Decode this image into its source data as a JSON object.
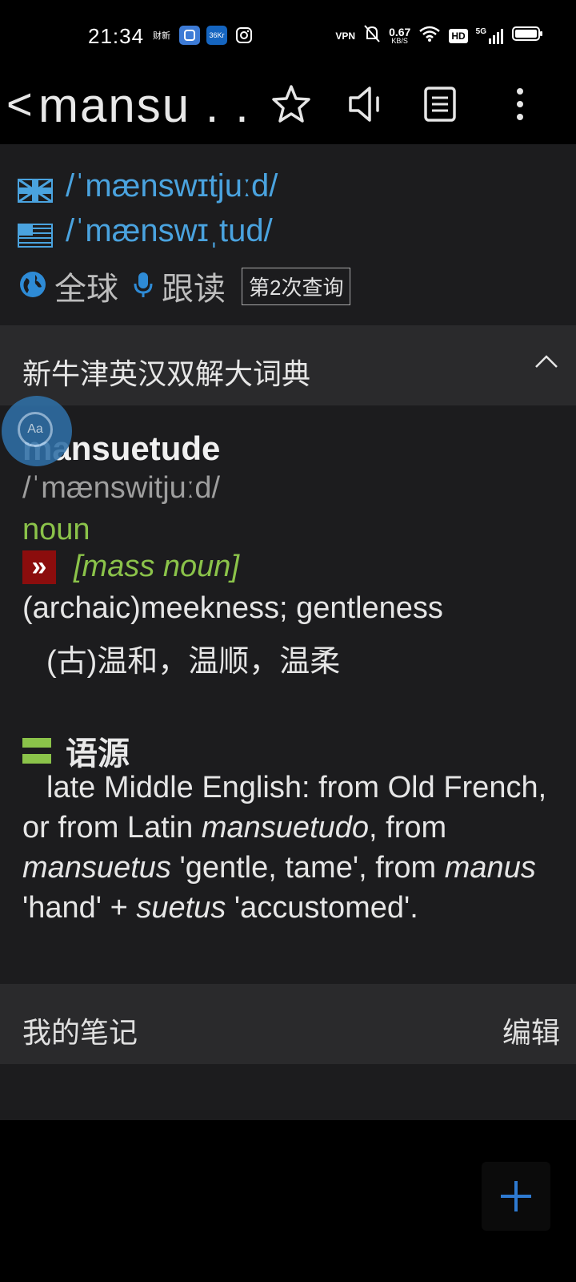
{
  "status_bar": {
    "time": "21:34",
    "app_icons": [
      "财新",
      "36Kr"
    ],
    "network_speed": "0.67",
    "network_unit": "KB/S",
    "vpn": "VPN",
    "hd": "HD",
    "signal": "5G"
  },
  "toolbar": {
    "title": "mansu . .",
    "back": "<"
  },
  "pronunciation": {
    "uk": "/ˈmænswɪtjuːd/",
    "us": "/ˈmænswɪˌtud/",
    "global_label": "全球",
    "follow_read_label": "跟读",
    "lookup_count": "第2次查询"
  },
  "dictionary": {
    "name": "新牛津英汉双解大词典",
    "headword": "mansuetude",
    "ipa": "/ˈmænswitjuːd/",
    "pos": "noun",
    "sense_marker": "»",
    "grammar": "[mass noun]",
    "definition_en": "(archaic)meekness; gentleness",
    "definition_zh": "(古)温和，温顺，温柔",
    "etymology_label": "语源",
    "etymology": {
      "t1": "late Middle English: from Old French, or from Latin ",
      "i1": "mansuetudo",
      "t2": ", from ",
      "i2": "mansuetus",
      "t3": " 'gentle, tame', from ",
      "i3": "manus",
      "t4": " 'hand' + ",
      "i4": "suetus",
      "t5": " 'accustomed'."
    }
  },
  "floating_button": {
    "label": "Aa"
  },
  "notes": {
    "label": "我的笔记",
    "edit": "编辑"
  },
  "colors": {
    "accent_blue": "#4aa3df",
    "green": "#8bc34a",
    "dark_red": "#8b0d0d"
  }
}
